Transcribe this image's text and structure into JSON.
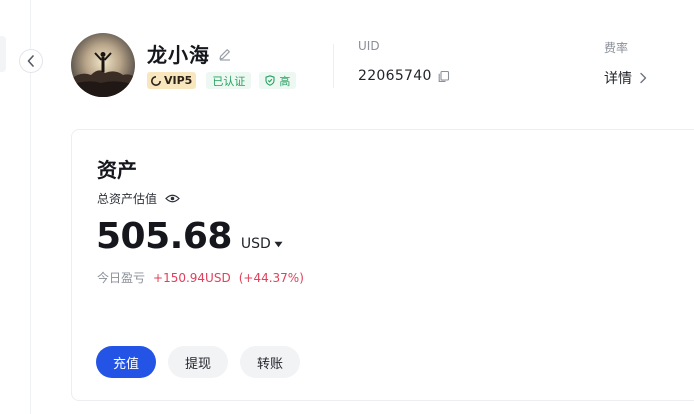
{
  "profile": {
    "username": "龙小海",
    "vip_label": "VIP5",
    "verified_label": "已认证",
    "security_label": "高"
  },
  "account": {
    "uid_label": "UID",
    "uid_value": "22065740",
    "fee_label": "费率",
    "fee_link": "详情"
  },
  "assets": {
    "title": "资产",
    "total_label": "总资产估值",
    "balance": "505.68",
    "currency": "USD",
    "pnl_label": "今日盈亏",
    "pnl_amount": "+150.94USD",
    "pnl_percent": "(+44.37%)"
  },
  "actions": {
    "deposit": "充值",
    "withdraw": "提现",
    "transfer": "转账"
  },
  "colors": {
    "primary": "#2354e6",
    "profit_loss": "#e2405a",
    "verified_green": "#27a160",
    "vip_gold": "#f8e6bf"
  },
  "icons": [
    "chevron-left-icon",
    "edit-icon",
    "vip-icon",
    "shield-check-icon",
    "copy-icon",
    "chevron-right-icon",
    "eye-icon",
    "caret-down-icon"
  ]
}
